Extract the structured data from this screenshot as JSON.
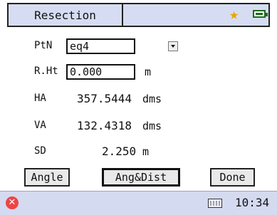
{
  "window": {
    "title": "Resection"
  },
  "status": {
    "star_icon": "favorite-star-icon",
    "battery_icon": "battery-icon"
  },
  "fields": {
    "ptn": {
      "label": "PtN",
      "value": "eq4"
    },
    "rht": {
      "label": "R.Ht",
      "value": "0.000",
      "unit": "m"
    },
    "ha": {
      "label": "HA",
      "value": "357.5444",
      "unit": "dms"
    },
    "va": {
      "label": "VA",
      "value": "132.4318",
      "unit": "dms"
    },
    "sd": {
      "label": "SD",
      "value": "2.250",
      "unit": "m"
    }
  },
  "buttons": {
    "angle": "Angle",
    "angdist": "Ang&Dist",
    "done": "Done"
  },
  "taskbar": {
    "time": "10:34"
  },
  "colors": {
    "title_bg": "#d6ddf2",
    "taskbar_bg": "#d4daf0",
    "star": "#e6a700",
    "battery": "#1d6b1d"
  }
}
